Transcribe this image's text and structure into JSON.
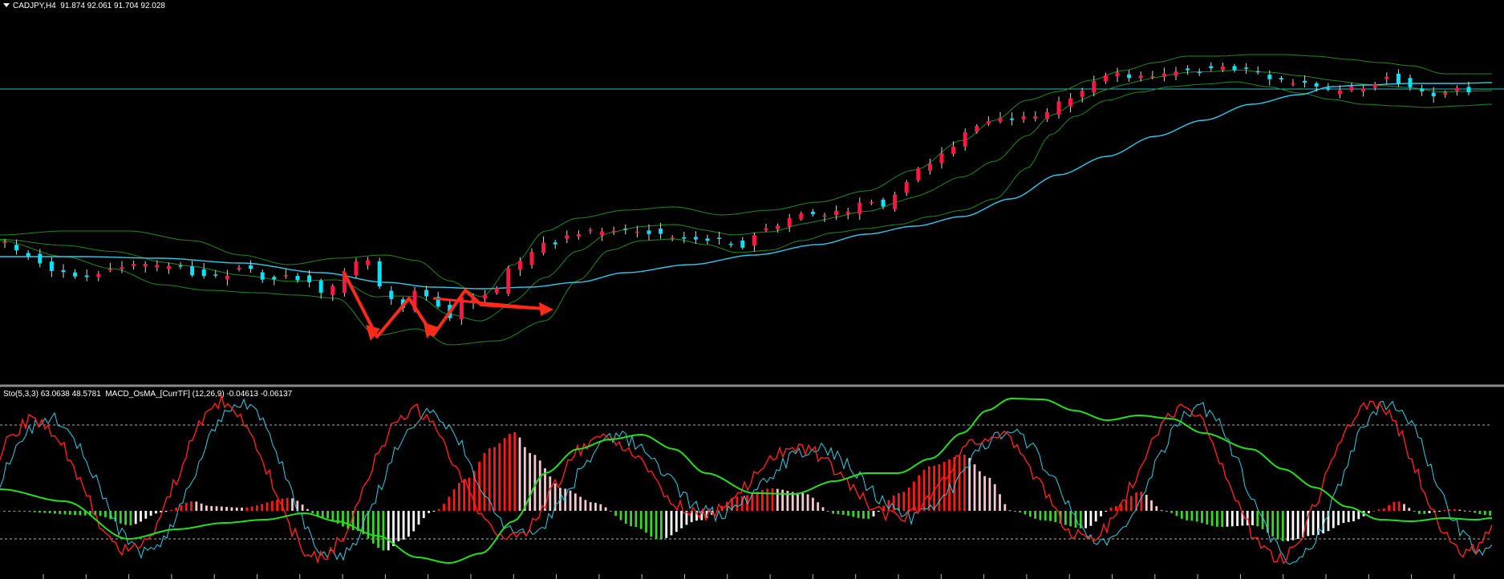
{
  "main_header": {
    "symbol": "CADJPY,H4",
    "ohlc": "91.874 92.061 91.704 92.028"
  },
  "sub_header": {
    "text": "Sto(5,3,3) 63.0638 48.5781  MACD_OsMA_[CurrTF] (12,26,9) -0.04613 -0.06137"
  },
  "colors": {
    "background": "#000000",
    "bull_candle": "#ff1744",
    "bear_candle": "#00e5ff",
    "bollinger": "#1f8a1f",
    "moving_average": "#2fc9ee",
    "horizontal_line": "#2fb6d0",
    "annotation_arrow": "#ff2a1a",
    "stoch_main": "#2fd0e6",
    "stoch_signal": "#ff2020",
    "macd_signal": "#22e01e",
    "osma_pos": "#ff1a1a",
    "osma_pos_fade": "#f5c8d0",
    "osma_neg": "#39d72a",
    "osma_neg_fade": "#ffffff",
    "separator": "#8a8a8a"
  },
  "chart_data": [
    {
      "type": "candlestick",
      "symbol": "CADJPY",
      "timeframe": "H4",
      "bar_count": 126,
      "trend": "flat with a double-bottom dip, then steady rally, then sideways consolidation",
      "indicators": [
        "Bollinger Bands",
        "Moving Average",
        "Horizontal Line"
      ],
      "annotation": "red zig-zag W-shaped double-bottom arrow pointing right"
    },
    {
      "type": "line",
      "name": "Stochastic(5,3,3)",
      "values_shown": [
        63.0638,
        48.5781
      ],
      "levels_dotted": 2
    },
    {
      "type": "bar",
      "name": "MACD_OsMA_[CurrTF] (12,26,9)",
      "values_shown": [
        -0.04613,
        -0.06137
      ]
    }
  ]
}
